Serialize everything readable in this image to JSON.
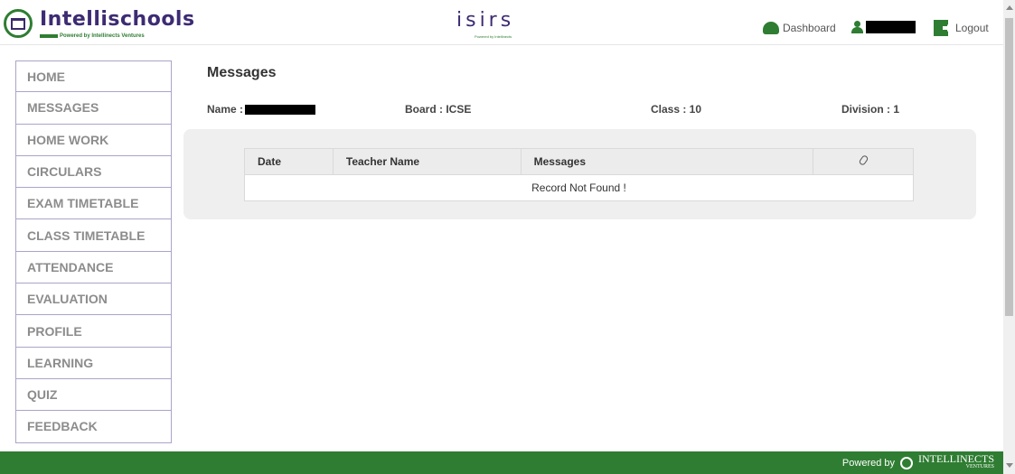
{
  "header": {
    "brand": "Intellischools",
    "brand_tagline": "Powered by Intellinects Ventures",
    "center_logo": "isirs",
    "center_tagline": "Powered by Intellinects",
    "dashboard_label": "Dashboard",
    "logout_label": "Logout"
  },
  "sidebar": {
    "items": [
      {
        "label": "HOME"
      },
      {
        "label": "MESSAGES"
      },
      {
        "label": "HOME WORK"
      },
      {
        "label": "CIRCULARS"
      },
      {
        "label": "EXAM TIMETABLE"
      },
      {
        "label": "CLASS TIMETABLE"
      },
      {
        "label": "ATTENDANCE"
      },
      {
        "label": "EVALUATION"
      },
      {
        "label": "PROFILE"
      },
      {
        "label": "LEARNING"
      },
      {
        "label": "QUIZ"
      },
      {
        "label": "FEEDBACK"
      }
    ]
  },
  "main": {
    "title": "Messages",
    "name_label": "Name :",
    "board": "Board : ICSE",
    "class": "Class : 10",
    "division": "Division : 1",
    "table": {
      "columns": [
        "Date",
        "Teacher Name",
        "Messages"
      ],
      "attachment_icon": "paperclip-icon",
      "empty_message": "Record Not Found !"
    }
  },
  "footer": {
    "powered_by": "Powered by",
    "company": "INTELLINECTS",
    "company_sub": "VENTURES"
  },
  "colors": {
    "brand_purple": "#3d2b73",
    "brand_green": "#2f7d32"
  }
}
